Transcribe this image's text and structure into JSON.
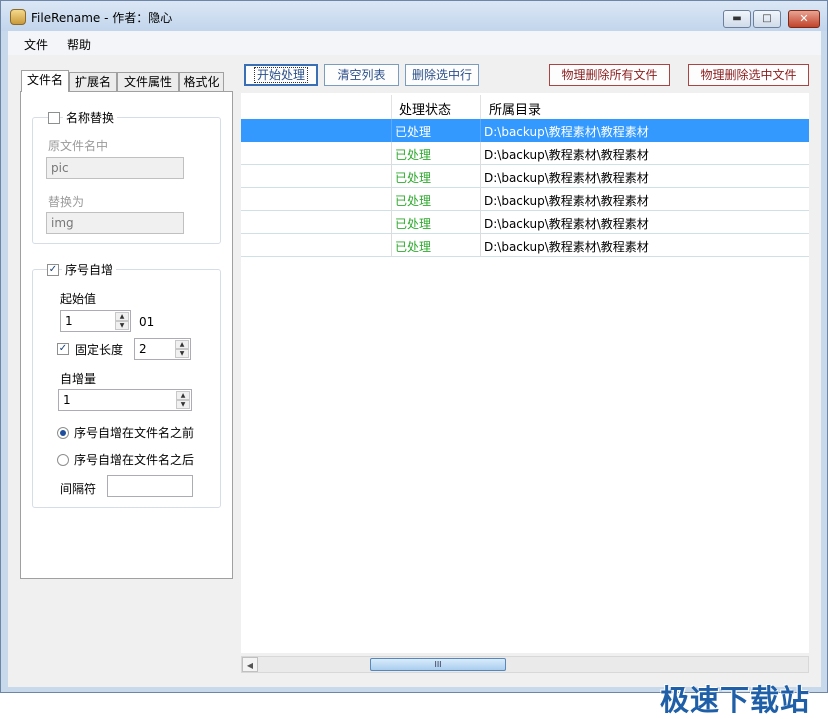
{
  "window": {
    "title": "FileRename - 作者：隐心",
    "minimize_glyph": "▬",
    "maximize_glyph": "□",
    "close_glyph": "✕"
  },
  "menu": {
    "file": "文件",
    "help": "帮助"
  },
  "tabs": [
    "文件名",
    "扩展名",
    "文件属性",
    "格式化"
  ],
  "name_replace": {
    "title": "名称替换",
    "checked": false,
    "original_label": "原文件名中",
    "original_value": "pic",
    "replace_label": "替换为",
    "replace_value": "img"
  },
  "sequence": {
    "title": "序号自增",
    "checked": true,
    "start_label": "起始值",
    "start_value": "1",
    "preview": "01",
    "fixed_length_label": "固定长度",
    "fixed_length_checked": true,
    "fixed_length_value": "2",
    "increment_label": "自增量",
    "increment_value": "1",
    "radio_before": "序号自增在文件名之前",
    "radio_after": "序号自增在文件名之后",
    "separator_label": "间隔符",
    "separator_value": ""
  },
  "toolbar": {
    "start": "开始处理",
    "clear": "清空列表",
    "delete_selected_rows": "删除选中行",
    "physical_delete_all": "物理删除所有文件",
    "physical_delete_selected": "物理删除选中文件"
  },
  "list": {
    "columns": [
      "处理状态",
      "所属目录"
    ],
    "rows": [
      {
        "status": "已处理",
        "dir": "D:\\backup\\教程素材\\教程素材",
        "selected": true
      },
      {
        "status": "已处理",
        "dir": "D:\\backup\\教程素材\\教程素材",
        "selected": false
      },
      {
        "status": "已处理",
        "dir": "D:\\backup\\教程素材\\教程素材",
        "selected": false
      },
      {
        "status": "已处理",
        "dir": "D:\\backup\\教程素材\\教程素材",
        "selected": false
      },
      {
        "status": "已处理",
        "dir": "D:\\backup\\教程素材\\教程素材",
        "selected": false
      },
      {
        "status": "已处理",
        "dir": "D:\\backup\\教程素材\\教程素材",
        "selected": false
      }
    ]
  },
  "scrollbar": {
    "left_arrow": "◀",
    "thumb_grip": "III"
  },
  "watermark": "极速下载站"
}
